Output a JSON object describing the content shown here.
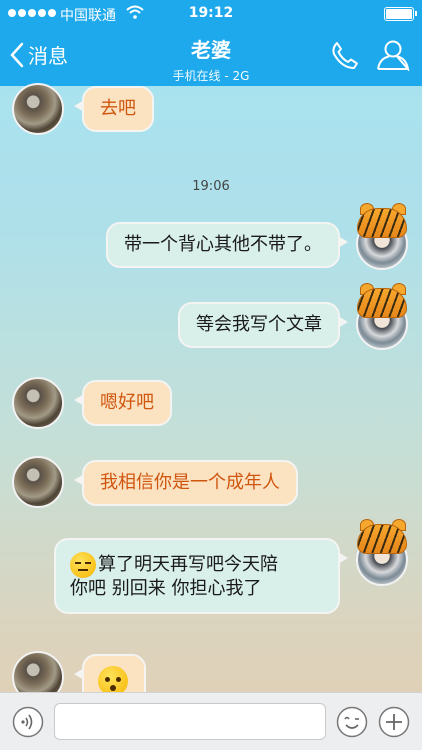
{
  "status_bar": {
    "carrier": "中国联通",
    "time": "19:12"
  },
  "header": {
    "back_label": "消息",
    "title": "老婆",
    "subtitle": "手机在线 - 2G",
    "icons": [
      "chevron-left-icon",
      "phone-icon",
      "profile-icon"
    ]
  },
  "chat": {
    "time_divider": "19:06",
    "messages": [
      {
        "side": "in",
        "text": "去吧"
      },
      {
        "side": "out",
        "text": "带一个背心其他不带了。"
      },
      {
        "side": "out",
        "text": "等会我写个文章"
      },
      {
        "side": "in",
        "text": "嗯好吧"
      },
      {
        "side": "in",
        "text": "我相信你是一个成年人"
      },
      {
        "side": "out",
        "text": "算了明天再写吧今天陪你吧 别回来 你担心我了",
        "line1": "算了明天再写吧今天陪",
        "line2": "你吧 别回来 你担心我了"
      },
      {
        "side": "in",
        "text": ""
      }
    ]
  },
  "input_bar": {
    "placeholder": "",
    "icons": [
      "voice-icon",
      "emoji-icon",
      "add-icon"
    ]
  },
  "colors": {
    "header_bg": "#1ea9ec",
    "incoming_bubble": "#fbe2c0",
    "incoming_text": "#d0560f",
    "outgoing_bubble": "#d8efea"
  }
}
